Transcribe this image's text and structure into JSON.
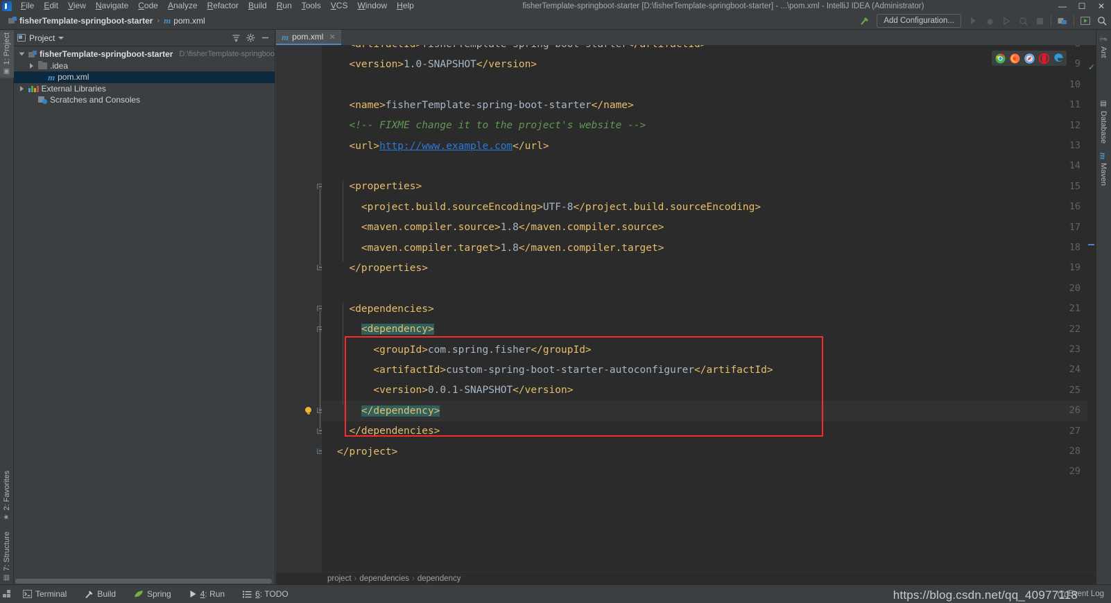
{
  "window": {
    "title": "fisherTemplate-springboot-starter [D:\\fisherTemplate-springboot-starter] - ...\\pom.xml - IntelliJ IDEA (Administrator)",
    "minimize": "—",
    "maximize": "☐",
    "close": "✕"
  },
  "menu": {
    "items": [
      {
        "label": "File"
      },
      {
        "label": "Edit"
      },
      {
        "label": "View"
      },
      {
        "label": "Navigate"
      },
      {
        "label": "Code"
      },
      {
        "label": "Analyze"
      },
      {
        "label": "Refactor"
      },
      {
        "label": "Build"
      },
      {
        "label": "Run"
      },
      {
        "label": "Tools"
      },
      {
        "label": "VCS"
      },
      {
        "label": "Window"
      },
      {
        "label": "Help"
      }
    ]
  },
  "navbar": {
    "crumbs": [
      {
        "label": "fisherTemplate-springboot-starter",
        "icon": "module-icon"
      },
      {
        "label": "pom.xml",
        "icon": "maven-file-icon"
      }
    ],
    "separator": "›",
    "add_configuration": "Add Configuration...",
    "buttons": [
      {
        "name": "build-hammer-icon",
        "glyph": "⚑"
      },
      {
        "name": "run-icon",
        "glyph": "▶"
      },
      {
        "name": "debug-icon",
        "glyph": "⚙"
      },
      {
        "name": "run-with-coverage-icon",
        "glyph": "◑"
      },
      {
        "name": "profile-icon",
        "glyph": "◎"
      },
      {
        "name": "stop-icon",
        "glyph": "■"
      },
      {
        "name": "project-structure-icon",
        "glyph": "☷"
      },
      {
        "name": "update-project-icon",
        "glyph": "▣"
      },
      {
        "name": "search-everywhere-icon",
        "glyph": "⌕"
      }
    ]
  },
  "left_stripe": {
    "top": [
      {
        "label": "1: Project",
        "selected": true,
        "icon": "project-icon"
      }
    ],
    "bottom": [
      {
        "label": "2: Favorites",
        "icon": "star-icon"
      },
      {
        "label": "7: Structure",
        "icon": "structure-icon"
      }
    ]
  },
  "right_stripe": {
    "items": [
      {
        "label": "Ant",
        "icon": "ant-icon"
      },
      {
        "label": "Database",
        "icon": "database-icon"
      },
      {
        "label": "Maven",
        "icon": "maven-icon"
      }
    ]
  },
  "project_panel": {
    "title": "Project",
    "actions": [
      {
        "name": "collapse-all-button",
        "glyph": "≡"
      },
      {
        "name": "settings-gear-button",
        "glyph": "⚙"
      },
      {
        "name": "hide-panel-button",
        "glyph": "—"
      }
    ],
    "tree": [
      {
        "label": "fisherTemplate-springboot-starter",
        "path": "D:\\fisherTemplate-springboot-starte",
        "icon": "module-icon",
        "indent": 0,
        "expanded": true,
        "bold": true,
        "selected": false
      },
      {
        "label": ".idea",
        "path": "",
        "icon": "folder-icon",
        "indent": 1,
        "expanded": false,
        "bold": false,
        "selected": false
      },
      {
        "label": "pom.xml",
        "path": "",
        "icon": "maven-file-icon",
        "indent": 2,
        "expanded": null,
        "bold": false,
        "selected": true
      },
      {
        "label": "External Libraries",
        "path": "",
        "icon": "library-icon",
        "indent": 0,
        "expanded": false,
        "bold": false,
        "selected": false
      },
      {
        "label": "Scratches and Consoles",
        "path": "",
        "icon": "scratches-icon",
        "indent": 1,
        "expanded": null,
        "bold": false,
        "selected": false
      }
    ]
  },
  "editor": {
    "tabs": [
      {
        "label": "pom.xml",
        "icon": "maven-file-icon",
        "active": true,
        "close": "✕"
      }
    ],
    "browser_bar": [
      {
        "name": "chrome-icon",
        "color": "#4285f4"
      },
      {
        "name": "firefox-icon",
        "color": "#ff6611"
      },
      {
        "name": "safari-icon",
        "color": "#4a9ae0"
      },
      {
        "name": "opera-icon",
        "color": "#e8152b"
      },
      {
        "name": "edge-icon",
        "color": "#2a9bd8"
      }
    ],
    "first_visible_line": 8,
    "lines": [
      {
        "n": 8,
        "clipped": true,
        "segments": [
          {
            "t": "  <artifactId>",
            "c": "tg"
          },
          {
            "t": "fisherTemplate-spring-boot-starter",
            "c": "tv"
          },
          {
            "t": "</artifactId>",
            "c": "tg"
          }
        ]
      },
      {
        "n": 9,
        "segments": [
          {
            "t": "  <version>",
            "c": "tg"
          },
          {
            "t": "1.0-SNAPSHOT",
            "c": "tv"
          },
          {
            "t": "</version>",
            "c": "tg"
          }
        ]
      },
      {
        "n": 10,
        "segments": []
      },
      {
        "n": 11,
        "segments": [
          {
            "t": "  <name>",
            "c": "tg"
          },
          {
            "t": "fisherTemplate-spring-boot-starter",
            "c": "tv"
          },
          {
            "t": "</name>",
            "c": "tg"
          }
        ]
      },
      {
        "n": 12,
        "segments": [
          {
            "t": "  <!-- ",
            "c": "cm"
          },
          {
            "t": "FIXME change it to the project's website ",
            "c": "cm"
          },
          {
            "t": "-->",
            "c": "cm"
          }
        ]
      },
      {
        "n": 13,
        "segments": [
          {
            "t": "  <url>",
            "c": "tg"
          },
          {
            "t": "http://www.example.com",
            "c": "lk"
          },
          {
            "t": "</url>",
            "c": "tg"
          }
        ]
      },
      {
        "n": 14,
        "segments": []
      },
      {
        "n": 15,
        "segments": [
          {
            "t": "  <properties>",
            "c": "tg"
          }
        ]
      },
      {
        "n": 16,
        "segments": [
          {
            "t": "    <project.build.sourceEncoding>",
            "c": "tg"
          },
          {
            "t": "UTF-8",
            "c": "tv"
          },
          {
            "t": "</project.build.sourceEncoding>",
            "c": "tg"
          }
        ]
      },
      {
        "n": 17,
        "segments": [
          {
            "t": "    <maven.compiler.source>",
            "c": "tg"
          },
          {
            "t": "1.8",
            "c": "tv"
          },
          {
            "t": "</maven.compiler.source>",
            "c": "tg"
          }
        ]
      },
      {
        "n": 18,
        "segments": [
          {
            "t": "    <maven.compiler.target>",
            "c": "tg"
          },
          {
            "t": "1.8",
            "c": "tv"
          },
          {
            "t": "</maven.compiler.target>",
            "c": "tg"
          }
        ]
      },
      {
        "n": 19,
        "segments": [
          {
            "t": "  </properties>",
            "c": "tg"
          }
        ]
      },
      {
        "n": 20,
        "segments": []
      },
      {
        "n": 21,
        "segments": [
          {
            "t": "  <dependencies>",
            "c": "tg"
          }
        ]
      },
      {
        "n": 22,
        "segments": [
          {
            "t": "    ",
            "c": "tg"
          },
          {
            "t": "<dependency>",
            "c": "tg sel-hl"
          }
        ]
      },
      {
        "n": 23,
        "segments": [
          {
            "t": "      <groupId>",
            "c": "tg"
          },
          {
            "t": "com.spring.fisher",
            "c": "tv"
          },
          {
            "t": "</groupId>",
            "c": "tg"
          }
        ]
      },
      {
        "n": 24,
        "segments": [
          {
            "t": "      <artifactId>",
            "c": "tg"
          },
          {
            "t": "custom-spring-boot-starter-autoconfigurer",
            "c": "tv"
          },
          {
            "t": "</artifactId>",
            "c": "tg"
          }
        ]
      },
      {
        "n": 25,
        "segments": [
          {
            "t": "      <version>",
            "c": "tg"
          },
          {
            "t": "0.0.1-SNAPSHOT",
            "c": "tv"
          },
          {
            "t": "</version>",
            "c": "tg"
          }
        ]
      },
      {
        "n": 26,
        "segments": [
          {
            "t": "    ",
            "c": "tg"
          },
          {
            "t": "</dependency>",
            "c": "tg sel-hl"
          }
        ]
      },
      {
        "n": 27,
        "segments": [
          {
            "t": "  </dependencies>",
            "c": "tg"
          }
        ]
      },
      {
        "n": 28,
        "segments": [
          {
            "t": "</project>",
            "c": "tg"
          }
        ]
      },
      {
        "n": 29,
        "segments": []
      }
    ],
    "caret_line": 26,
    "intention_bulb_line": 26,
    "highlight_box": {
      "from_line": 22,
      "to_line": 26,
      "color": "#fa2b2b"
    },
    "breadcrumbs": [
      "project",
      "dependencies",
      "dependency"
    ],
    "breadcrumb_separator": "›",
    "inspection_status": "✓"
  },
  "statusbar": {
    "items": [
      {
        "label": "Terminal",
        "icon": "terminal-icon"
      },
      {
        "label": "Build",
        "icon": "hammer-icon"
      },
      {
        "label": "Spring",
        "icon": "spring-leaf-icon"
      },
      {
        "label": "4: Run",
        "icon": "run-icon"
      },
      {
        "label": "6: TODO",
        "icon": "todo-list-icon"
      }
    ],
    "event_log": "Event Log"
  },
  "watermark": "https://blog.csdn.net/qq_40977118",
  "colors": {
    "accent": "#4a88c7",
    "editor_bg": "#2b2b2b",
    "panel_bg": "#3c3f41",
    "gutter_bg": "#313335",
    "selection_tree": "#0d293e",
    "tag": "#e8bf6a",
    "value": "#a9b7c6",
    "comment": "#629755",
    "link": "#287bde",
    "highlight_box": "#fa2b2b",
    "sel_highlight": "#30605b"
  }
}
